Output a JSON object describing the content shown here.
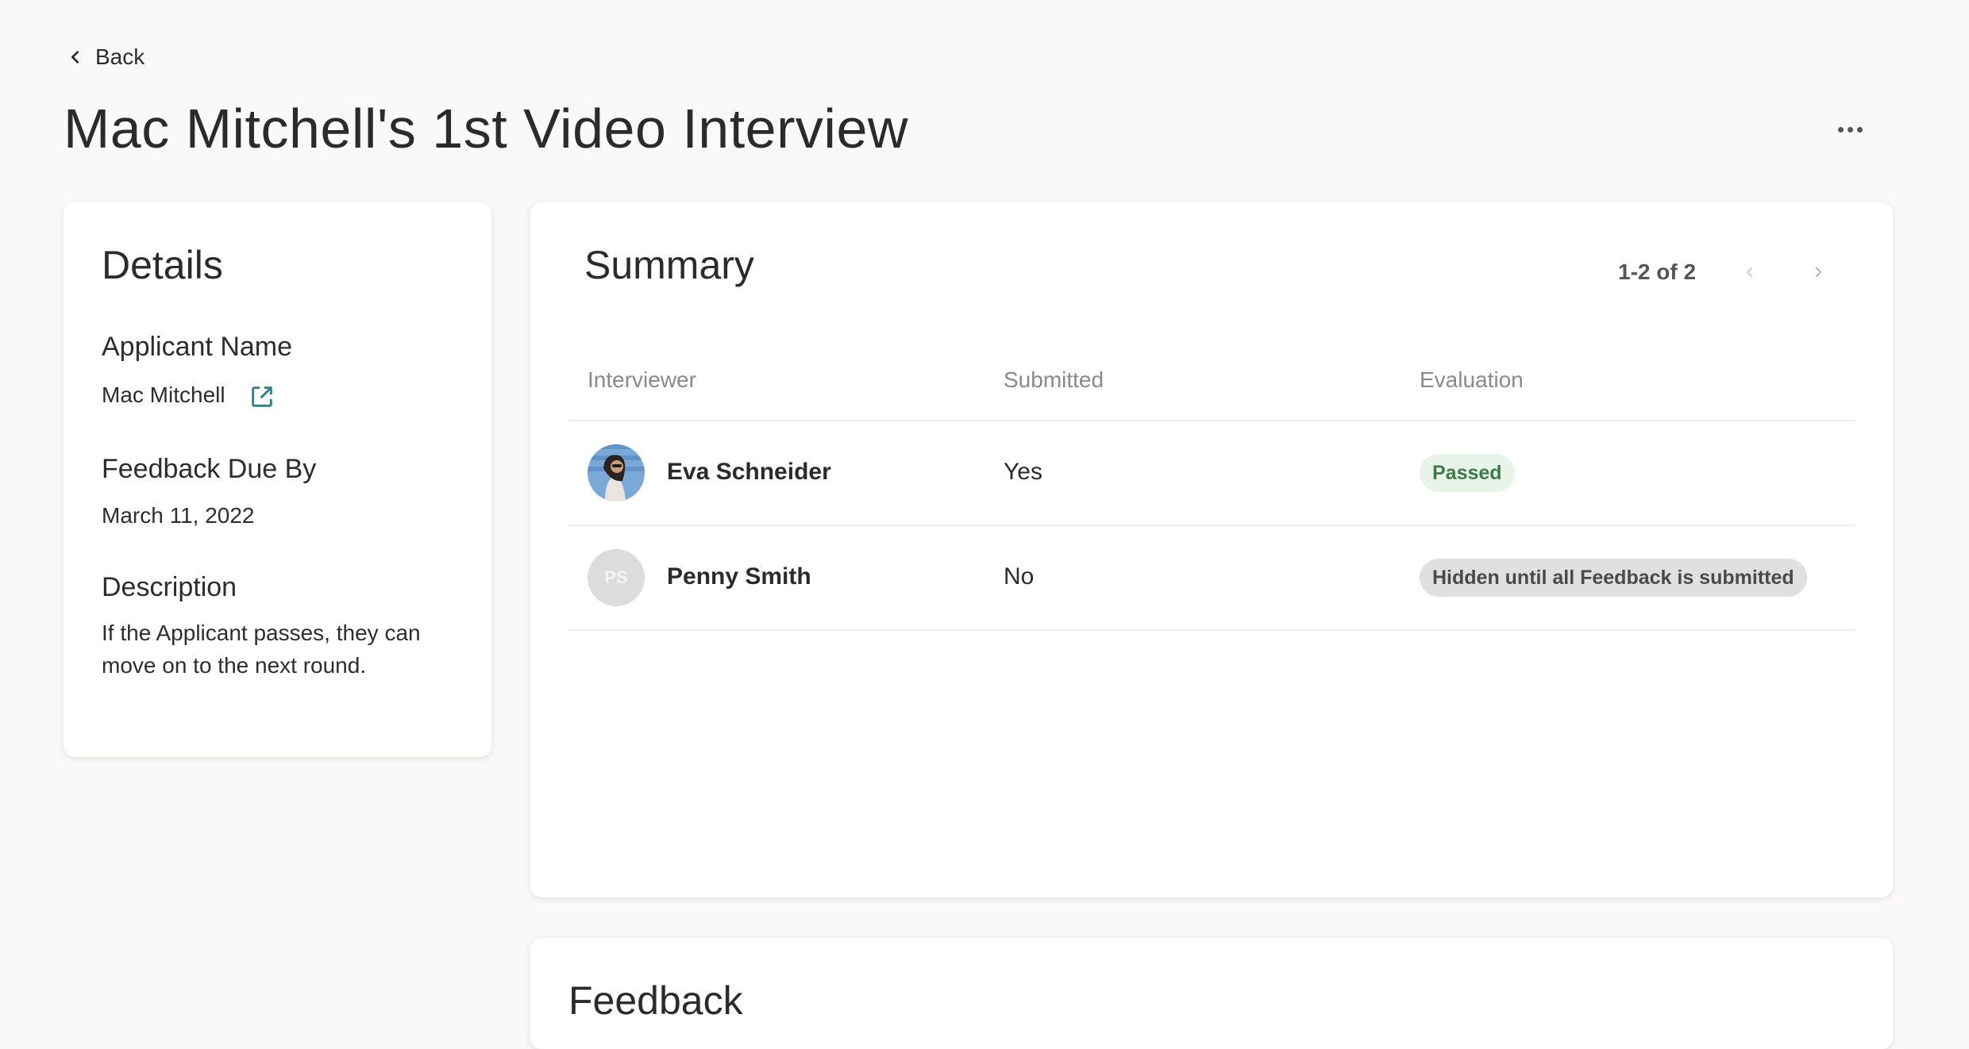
{
  "nav": {
    "back_label": "Back"
  },
  "page": {
    "title": "Mac Mitchell's 1st Video Interview"
  },
  "details": {
    "heading": "Details",
    "applicant_label": "Applicant Name",
    "applicant_name": "Mac Mitchell",
    "due_label": "Feedback Due By",
    "due_date": "March 11, 2022",
    "description_label": "Description",
    "description": "If the Applicant passes, they can move on to the next round."
  },
  "summary": {
    "heading": "Summary",
    "pager": "1-2 of 2",
    "columns": [
      "Interviewer",
      "Submitted",
      "Evaluation"
    ],
    "rows": [
      {
        "name": "Eva Schneider",
        "submitted": "Yes",
        "evaluation": "Passed",
        "initials": ""
      },
      {
        "name": "Penny Smith",
        "submitted": "No",
        "evaluation": "Hidden until all Feedback is submitted",
        "initials": "PS"
      }
    ]
  },
  "feedback": {
    "heading": "Feedback"
  },
  "colors": {
    "accent": "#2f7f86",
    "passed_bg": "#e8f4ea",
    "passed_text": "#3d7a47"
  },
  "icons": [
    "chevron-left-icon",
    "more-horizontal-icon",
    "external-link-icon",
    "chevron-right-icon"
  ]
}
